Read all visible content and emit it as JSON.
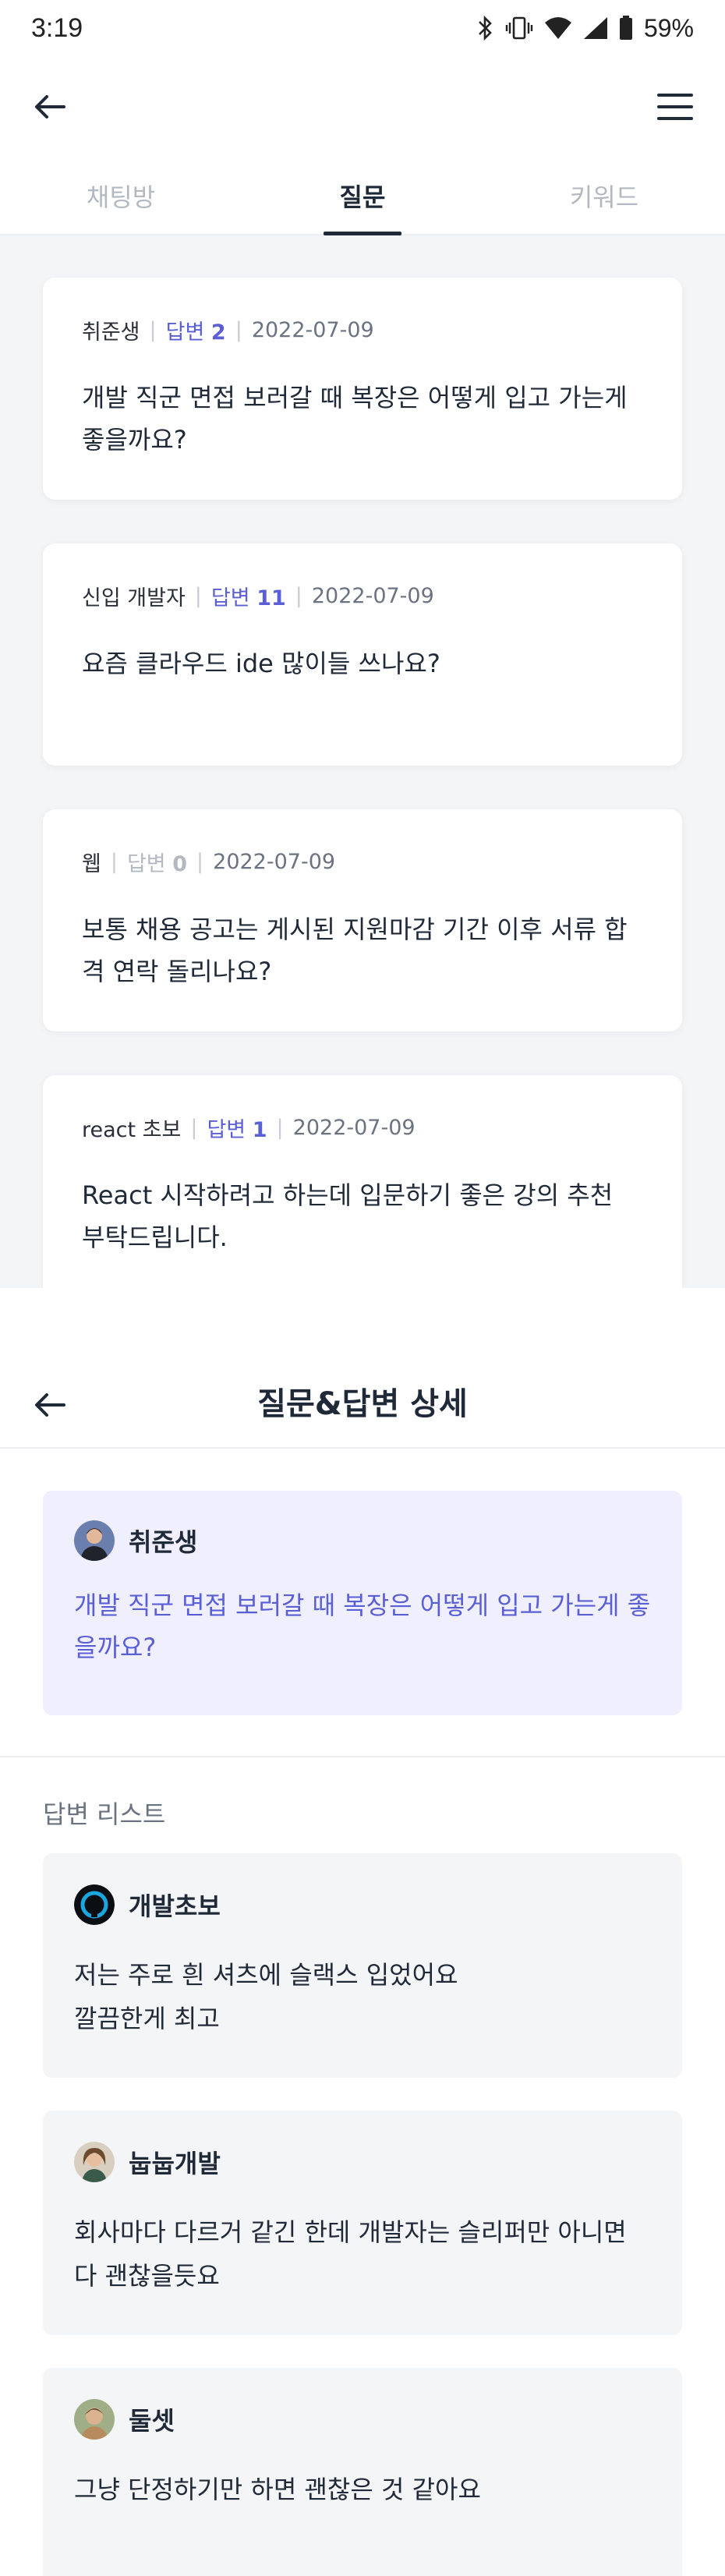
{
  "status_bar": {
    "time": "3:19",
    "battery": "59%"
  },
  "list_screen": {
    "tabs": [
      {
        "label": "채팅방",
        "active": false
      },
      {
        "label": "질문",
        "active": true
      },
      {
        "label": "키워드",
        "active": false
      }
    ],
    "questions": [
      {
        "author": "취준생",
        "answer_label": "답변",
        "answer_count": "2",
        "date": "2022-07-09",
        "text": "개발 직군 면접 보러갈 때 복장은 어떻게 입고 가는게 좋을까요?"
      },
      {
        "author": "신입 개발자",
        "answer_label": "답변",
        "answer_count": "11",
        "date": "2022-07-09",
        "text": "요즘 클라우드 ide 많이들 쓰나요?"
      },
      {
        "author": "웹",
        "answer_label": "답변",
        "answer_count": "0",
        "date": "2022-07-09",
        "text": "보통 채용 공고는 게시된 지원마감 기간 이후 서류 합격 연락 돌리나요?"
      },
      {
        "author": "react 초보",
        "answer_label": "답변",
        "answer_count": "1",
        "date": "2022-07-09",
        "text": "React 시작하려고 하는데 입문하기 좋은 강의 추천 부탁드립니다."
      }
    ]
  },
  "detail_screen": {
    "title": "질문&답변 상세",
    "question": {
      "author": "취준생",
      "text": "개발 직군 면접 보러갈 때 복장은 어떻게 입고 가는게 좋을까요?"
    },
    "answers_title": "답변 리스트",
    "answers": [
      {
        "author": "개발초보",
        "text": "저는 주로 흰 셔츠에 슬랙스 입었어요\n깔끔한게 최고"
      },
      {
        "author": "눕눕개발",
        "text": "회사마다 다르거 같긴 한데 개발자는 슬리퍼만 아니면 다 괜찮을듯요"
      },
      {
        "author": "둘셋",
        "text": "그냥 단정하기만 하면 괜찮은 것 같아요"
      }
    ]
  },
  "colors": {
    "accent": "#5b5fd6",
    "question_bg": "#efeffd",
    "card_bg": "#f4f5f7",
    "text": "#1f2937"
  }
}
